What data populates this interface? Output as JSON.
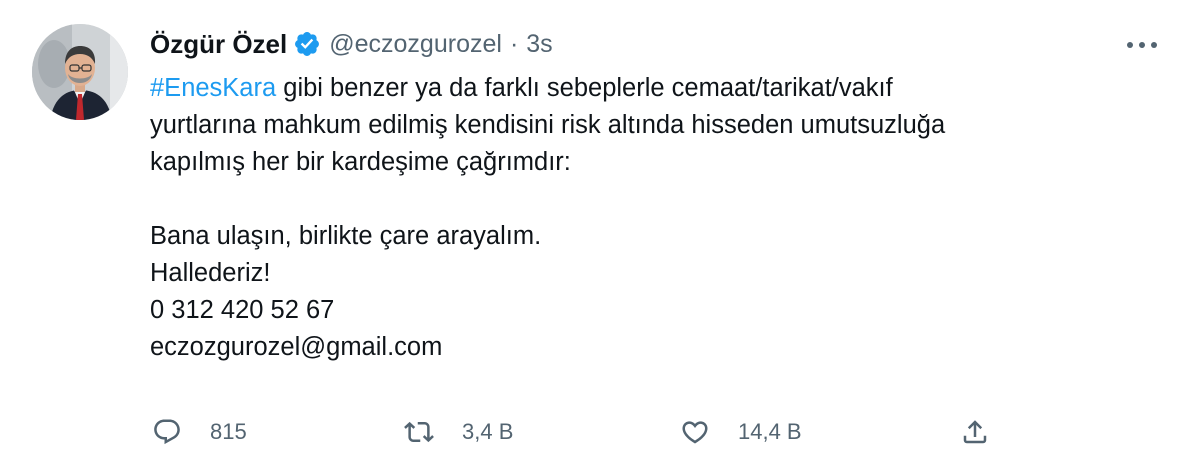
{
  "tweet": {
    "author": {
      "display_name": "Özgür Özel",
      "handle": "@eczozgurozel",
      "verified": true
    },
    "separator": "·",
    "time": "3s",
    "text": {
      "hashtag": "#EnesKara",
      "line1_rest": " gibi benzer ya da farklı sebeplerle cemaat/tarikat/vakıf",
      "line2": "yurtlarına mahkum edilmiş kendisini risk altında hisseden umutsuzluğa",
      "line3": "kapılmış her bir kardeşime çağrımdır:",
      "line4": "Bana ulaşın, birlikte çare arayalım.",
      "line5": "Hallederiz!",
      "line6": "0 312 420 52 67",
      "line7": "eczozgurozel@gmail.com"
    },
    "actions": {
      "replies": "815",
      "retweets": "3,4 B",
      "likes": "14,4 B"
    }
  },
  "colors": {
    "link": "#1d9bf0",
    "secondary_text": "#536471",
    "primary_text": "#0f1419",
    "verified_badge": "#1d9bf0"
  },
  "icons": {
    "more": "more-dots-icon",
    "reply": "reply-bubble-icon",
    "retweet": "retweet-arrows-icon",
    "like": "heart-icon",
    "share": "share-upload-icon",
    "verified": "verified-badge-icon"
  }
}
